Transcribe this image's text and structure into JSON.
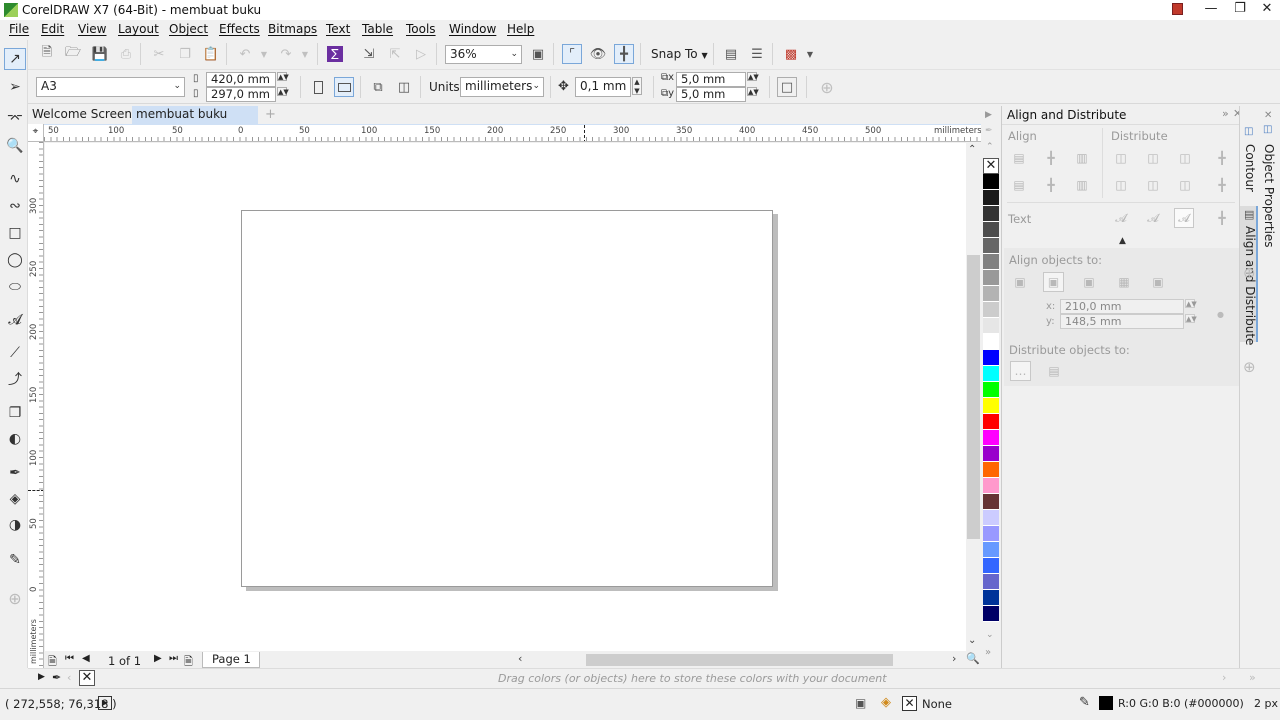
{
  "window": {
    "title": "CorelDRAW X7 (64-Bit) - membuat buku",
    "controls": [
      "profile-icon",
      "minimize-icon",
      "restore-icon",
      "close-icon"
    ]
  },
  "menu": [
    "File",
    "Edit",
    "View",
    "Layout",
    "Object",
    "Effects",
    "Bitmaps",
    "Text",
    "Table",
    "Tools",
    "Window",
    "Help"
  ],
  "standard_toolbar": {
    "zoom_value": "36%",
    "snap_to_label": "Snap To"
  },
  "property_bar": {
    "paper_size": "A3",
    "page_width": "420,0 mm",
    "page_height": "297,0 mm",
    "units_label": "Units:",
    "units_value": "millimeters",
    "nudge_distance": "0,1 mm",
    "duplicate_x": "5,0 mm",
    "duplicate_y": "5,0 mm"
  },
  "document_tabs": {
    "tabs": [
      "Welcome Screen",
      "membuat buku"
    ],
    "active": "membuat buku",
    "add_symbol": "+"
  },
  "rulers": {
    "horizontal_labels": [
      "50",
      "100",
      "50",
      "0",
      "50",
      "100",
      "150",
      "200",
      "250",
      "300",
      "350",
      "400",
      "450",
      "500"
    ],
    "horizontal_unit": "millimeters",
    "vertical_labels": [
      "300",
      "250",
      "200",
      "150",
      "100",
      "50",
      "0"
    ],
    "vertical_unit": "millimeters"
  },
  "page_navigator": {
    "page_count_text": "1 of 1",
    "page_tab": "Page 1"
  },
  "color_palette": {
    "swatches": [
      "#000000",
      "#1a1a1a",
      "#333333",
      "#4d4d4d",
      "#666666",
      "#808080",
      "#999999",
      "#b3b3b3",
      "#cccccc",
      "#e6e6e6",
      "#ffffff",
      "#0000ff",
      "#00ffff",
      "#00ff00",
      "#ffff00",
      "#ff0000",
      "#ff00ff",
      "#9900cc",
      "#ff6600",
      "#ff99cc",
      "#663333",
      "#ccccff",
      "#9999ff",
      "#6699ff",
      "#3366ff",
      "#6666cc",
      "#003399",
      "#000066"
    ]
  },
  "docker": {
    "title": "Align and Distribute",
    "align_label": "Align",
    "distribute_label": "Distribute",
    "text_label": "Text",
    "align_objects_to_label": "Align objects to:",
    "x_label": "x:",
    "x_value": "210,0 mm",
    "y_label": "y:",
    "y_value": "148,5 mm",
    "distribute_objects_to_label": "Distribute objects to:",
    "side_tabs": [
      "Object Properties",
      "Contour",
      "Align and Distribute"
    ]
  },
  "drop_bar": {
    "hint": "Drag colors (or objects) here to store these colors with your document"
  },
  "status_bar": {
    "coordinates": "( 272,558; 76,318 )",
    "fill_label": "None",
    "outline_color_text": "R:0 G:0 B:0 (#000000)",
    "outline_width": "2 px"
  }
}
